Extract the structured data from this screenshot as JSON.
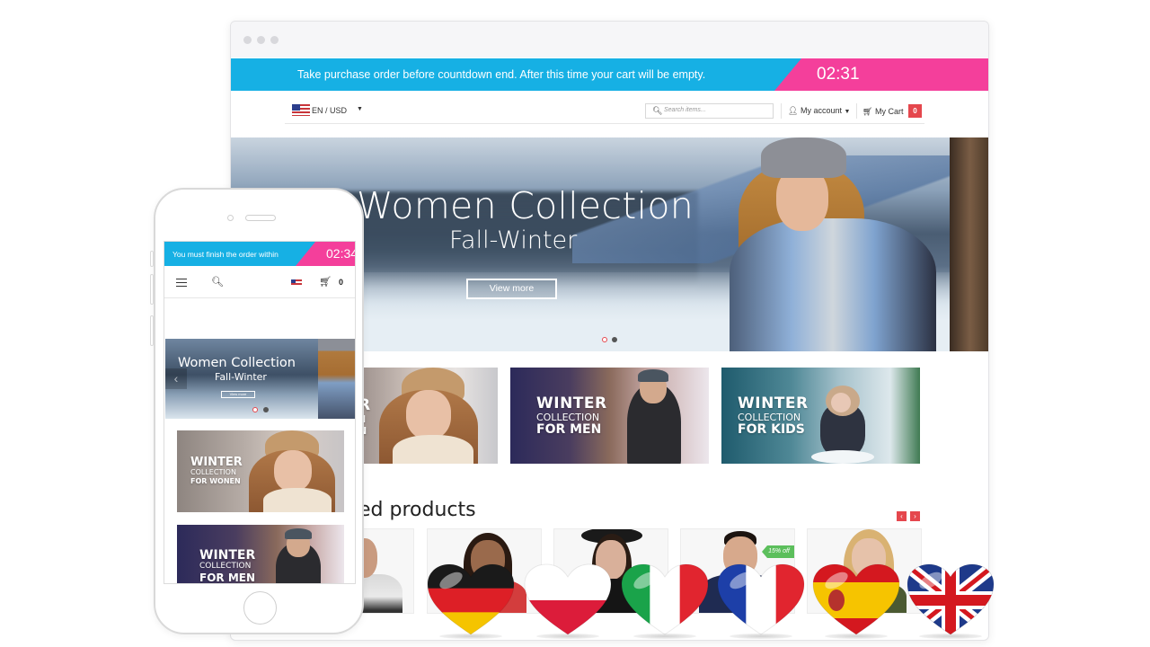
{
  "browser": {
    "countdown": {
      "message": "Take purchase order before countdown end. After this time your cart will be empty.",
      "time": "02:31",
      "colors": {
        "primary": "#16b0e4",
        "accent": "#f43f9b"
      }
    },
    "topnav": {
      "language_currency": "EN / USD",
      "language_icon": "us-flag-icon",
      "search_placeholder": "Search items...",
      "account_label": "My account",
      "cart_label": "My Cart",
      "cart_count": "0"
    },
    "hero": {
      "title": "Women Collection",
      "subtitle": "Fall-Winter",
      "button_label": "View more",
      "slides_total": 2,
      "active_slide": 1
    },
    "banners": [
      {
        "line1": "WINTER",
        "line2": "COLLECTION",
        "line3": "FOR WOMEN",
        "visible_partial": [
          "R",
          "N",
          "N"
        ]
      },
      {
        "line1": "WINTER",
        "line2": "COLLECTION",
        "line3": "FOR MEN"
      },
      {
        "line1": "WINTER",
        "line2": "COLLECTION",
        "line3": "FOR KIDS"
      }
    ],
    "featured": {
      "title_visible": "ed products",
      "prev_label": "‹",
      "next_label": "›",
      "products": [
        {
          "badge": ""
        },
        {
          "badge": ""
        },
        {
          "badge": ""
        },
        {
          "badge": "15% off"
        },
        {
          "badge": ""
        }
      ]
    }
  },
  "phone": {
    "countdown": {
      "message": "You must finish the order within",
      "time": "02:34"
    },
    "nav": {
      "menu_icon": "hamburger-icon",
      "search_icon": "search-icon",
      "flag_icon": "us-flag-icon",
      "cart_icon": "cart-icon",
      "cart_count": "0"
    },
    "hero": {
      "title": "Women Collection",
      "subtitle": "Fall-Winter",
      "button_label": "View more",
      "prev_label": "‹"
    },
    "banners": [
      {
        "line1": "WINTER",
        "line2": "COLLECTION",
        "line3": "FOR WONEN"
      },
      {
        "line1": "WINTER",
        "line2": "COLLECTION",
        "line3": "FOR MEN"
      }
    ]
  },
  "language_hearts": [
    {
      "name": "german-flag-heart",
      "colors": [
        "#1a1a1a",
        "#dd1f26",
        "#f5c400"
      ],
      "layout": "horizontal"
    },
    {
      "name": "polish-flag-heart",
      "colors": [
        "#ffffff",
        "#dc1c3a"
      ],
      "layout": "horizontal"
    },
    {
      "name": "italian-flag-heart",
      "colors": [
        "#1aa34a",
        "#ffffff",
        "#e1252f"
      ],
      "layout": "vertical"
    },
    {
      "name": "french-flag-heart",
      "colors": [
        "#1d3fa8",
        "#ffffff",
        "#e1252f"
      ],
      "layout": "vertical"
    },
    {
      "name": "spanish-flag-heart",
      "colors": [
        "#d4181f",
        "#f6c400",
        "#d4181f"
      ],
      "layout": "horizontal-spain"
    },
    {
      "name": "uk-flag-heart",
      "colors": [
        "#1e3a8a",
        "#ffffff",
        "#d4181f"
      ],
      "layout": "union-jack"
    }
  ]
}
